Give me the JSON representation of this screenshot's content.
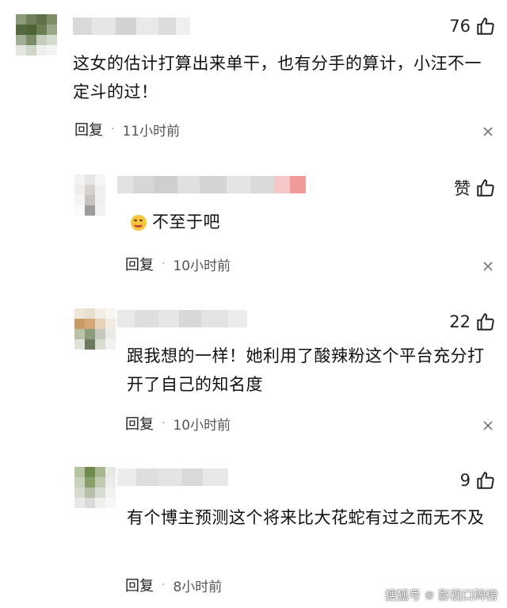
{
  "comments": [
    {
      "likes": "76",
      "text": "这女的估计打算出来单干，也有分手的算计，小汪不一定斗的过！",
      "reply_label": "回复",
      "dot": "·",
      "time": "11小时前"
    },
    {
      "likes": "赞",
      "text": "不至于吧",
      "emoji": "face-emoji",
      "reply_label": "回复",
      "dot": "·",
      "time": "10小时前"
    },
    {
      "likes": "22",
      "text": "跟我想的一样！她利用了酸辣粉这个平台充分打开了自己的知名度",
      "reply_label": "回复",
      "dot": "·",
      "time": "10小时前"
    },
    {
      "likes": "9",
      "text": "有个博主预测这个将来比大花蛇有过之而无不及",
      "reply_label": "回复",
      "dot": "·",
      "time": "8小时前"
    }
  ],
  "watermark": {
    "prefix": "搜狐号",
    "at": "@",
    "name": "影视口碑榜"
  },
  "icons": {
    "like": "thumbs-up-icon",
    "close": "close-icon"
  },
  "colors": {
    "text": "#111111",
    "meta": "#555555",
    "background": "#ffffff"
  }
}
